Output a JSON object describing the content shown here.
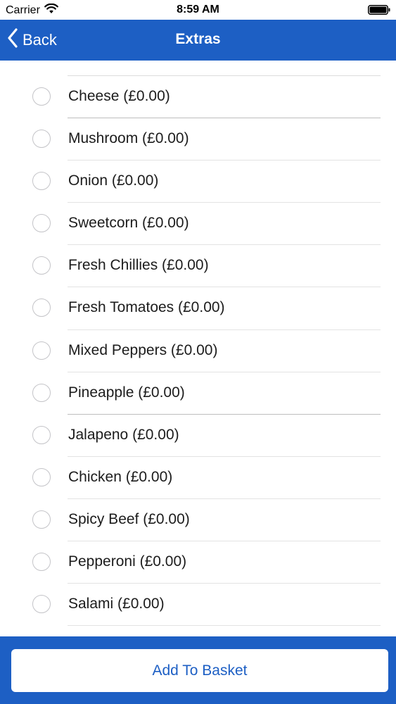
{
  "status_bar": {
    "carrier": "Carrier",
    "time": "8:59 AM"
  },
  "nav": {
    "back_label": "Back",
    "title": "Extras"
  },
  "extras": [
    {
      "label": "Cheese (£0.00)",
      "selected": false
    },
    {
      "label": "Mushroom (£0.00)",
      "selected": false
    },
    {
      "label": "Onion (£0.00)",
      "selected": false
    },
    {
      "label": "Sweetcorn (£0.00)",
      "selected": false
    },
    {
      "label": "Fresh Chillies (£0.00)",
      "selected": false
    },
    {
      "label": "Fresh Tomatoes (£0.00)",
      "selected": false
    },
    {
      "label": "Mixed Peppers (£0.00)",
      "selected": false
    },
    {
      "label": "Pineapple (£0.00)",
      "selected": false
    },
    {
      "label": "Jalapeno (£0.00)",
      "selected": false
    },
    {
      "label": "Chicken (£0.00)",
      "selected": false
    },
    {
      "label": "Spicy Beef (£0.00)",
      "selected": false
    },
    {
      "label": "Pepperoni (£0.00)",
      "selected": false
    },
    {
      "label": "Salami (£0.00)",
      "selected": false
    }
  ],
  "footer": {
    "add_button_label": "Add To Basket"
  },
  "colors": {
    "brand": "#1d5fc4",
    "background": "#ffffff",
    "radio_border": "#c4c4c8"
  },
  "icons": {
    "signal": "wifi-icon",
    "battery": "battery-icon",
    "back": "chevron-left-icon",
    "radio": "radio-circle-icon"
  }
}
